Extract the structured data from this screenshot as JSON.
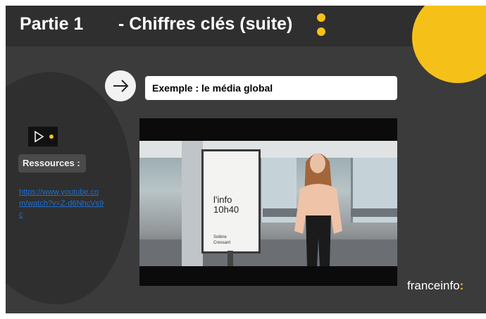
{
  "header": {
    "part_label": "Partie 1",
    "title": "- Chiffres clés (suite)"
  },
  "example": {
    "label": "Exemple : le média global"
  },
  "sidebar": {
    "resources_label": "Ressources :",
    "link_text": "https://www.youtube.com/watch?v=Z-d6NhcVs9c"
  },
  "video": {
    "sign_text_line1": "l'info",
    "sign_text_line2": "10h40",
    "sign_small_line1": "Solène",
    "sign_small_line2": "Cressant"
  },
  "logo": {
    "text": "franceinfo",
    "suffix": ":"
  },
  "icons": {
    "arrow": "arrow-right-icon",
    "play": "play-icon",
    "dots": "vertical-dots-icon"
  },
  "colors": {
    "background": "#3b3b3b",
    "header": "#2f2f2f",
    "accent_yellow": "#f5c118",
    "link_blue": "#1f6fd1"
  }
}
